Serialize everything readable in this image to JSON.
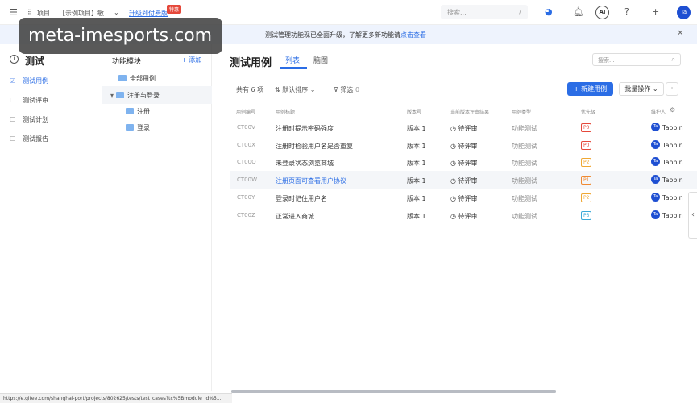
{
  "topbar": {
    "project_label": "项目",
    "project_name": "【示例项目】敏...",
    "upgrade_label": "升级到付费版",
    "offer_badge": "特惠",
    "search_placeholder": "搜索...",
    "search_shortcut": "/",
    "ai_label": "AI",
    "avatar": "Ta"
  },
  "notice": {
    "message": "测试管理功能现已全面升级，了解更多新功能请",
    "link": "点击查看"
  },
  "watermark": "meta-imesports.com",
  "nav": {
    "title": "测试",
    "items": [
      {
        "label": "测试用例",
        "icon": "test-case-icon"
      },
      {
        "label": "测试评审",
        "icon": "review-icon"
      },
      {
        "label": "测试计划",
        "icon": "plan-icon"
      },
      {
        "label": "测试报告",
        "icon": "report-icon"
      }
    ]
  },
  "tree": {
    "header": "功能模块",
    "add_label": "+ 添加",
    "nodes": [
      {
        "label": "全部用例"
      },
      {
        "label": "注册与登录"
      },
      {
        "label": "注册"
      },
      {
        "label": "登录"
      }
    ]
  },
  "main": {
    "title": "测试用例",
    "tabs": [
      {
        "label": "列表"
      },
      {
        "label": "脑图"
      }
    ],
    "search_placeholder": "搜索...",
    "count_text": "共有 6 项",
    "sort_label": "默认排序",
    "filter_label": "筛选",
    "filter_count": "0",
    "new_button": "+ 新建用例",
    "batch_button": "批量操作",
    "more_button": "···",
    "columns": [
      "用例编号",
      "用例标题",
      "版本号",
      "当前版本评审结果",
      "用例类型",
      "优先级",
      "维护人"
    ],
    "rows": [
      {
        "id": "CT00V",
        "title": "注册时提示密码强度",
        "version": "版本 1",
        "review": "待评审",
        "type": "功能测试",
        "priority": "P0",
        "priority_color": "#e5483a",
        "owner": "Taobin"
      },
      {
        "id": "CT00X",
        "title": "注册时检验用户名是否重复",
        "version": "版本 1",
        "review": "待评审",
        "type": "功能测试",
        "priority": "P0",
        "priority_color": "#e5483a",
        "owner": "Taobin"
      },
      {
        "id": "CT00Q",
        "title": "未登录状态浏览商城",
        "version": "版本 1",
        "review": "待评审",
        "type": "功能测试",
        "priority": "P2",
        "priority_color": "#f0a732",
        "owner": "Taobin"
      },
      {
        "id": "CT00W",
        "title": "注册页面可查看用户协议",
        "version": "版本 1",
        "review": "待评审",
        "type": "功能测试",
        "priority": "P1",
        "priority_color": "#f08a32",
        "owner": "Taobin"
      },
      {
        "id": "CT00Y",
        "title": "登录时记住用户名",
        "version": "版本 1",
        "review": "待评审",
        "type": "功能测试",
        "priority": "P2",
        "priority_color": "#f0a732",
        "owner": "Taobin"
      },
      {
        "id": "CT00Z",
        "title": "正常进入商城",
        "version": "版本 1",
        "review": "待评审",
        "type": "功能测试",
        "priority": "P3",
        "priority_color": "#3aa9d8",
        "owner": "Taobin"
      }
    ],
    "row_avatar": "Ta"
  },
  "status_url": "https://e.gitee.com/shanghai-port/projects/802625/tests/test_cases?tc%5Bmodule_id%5..."
}
